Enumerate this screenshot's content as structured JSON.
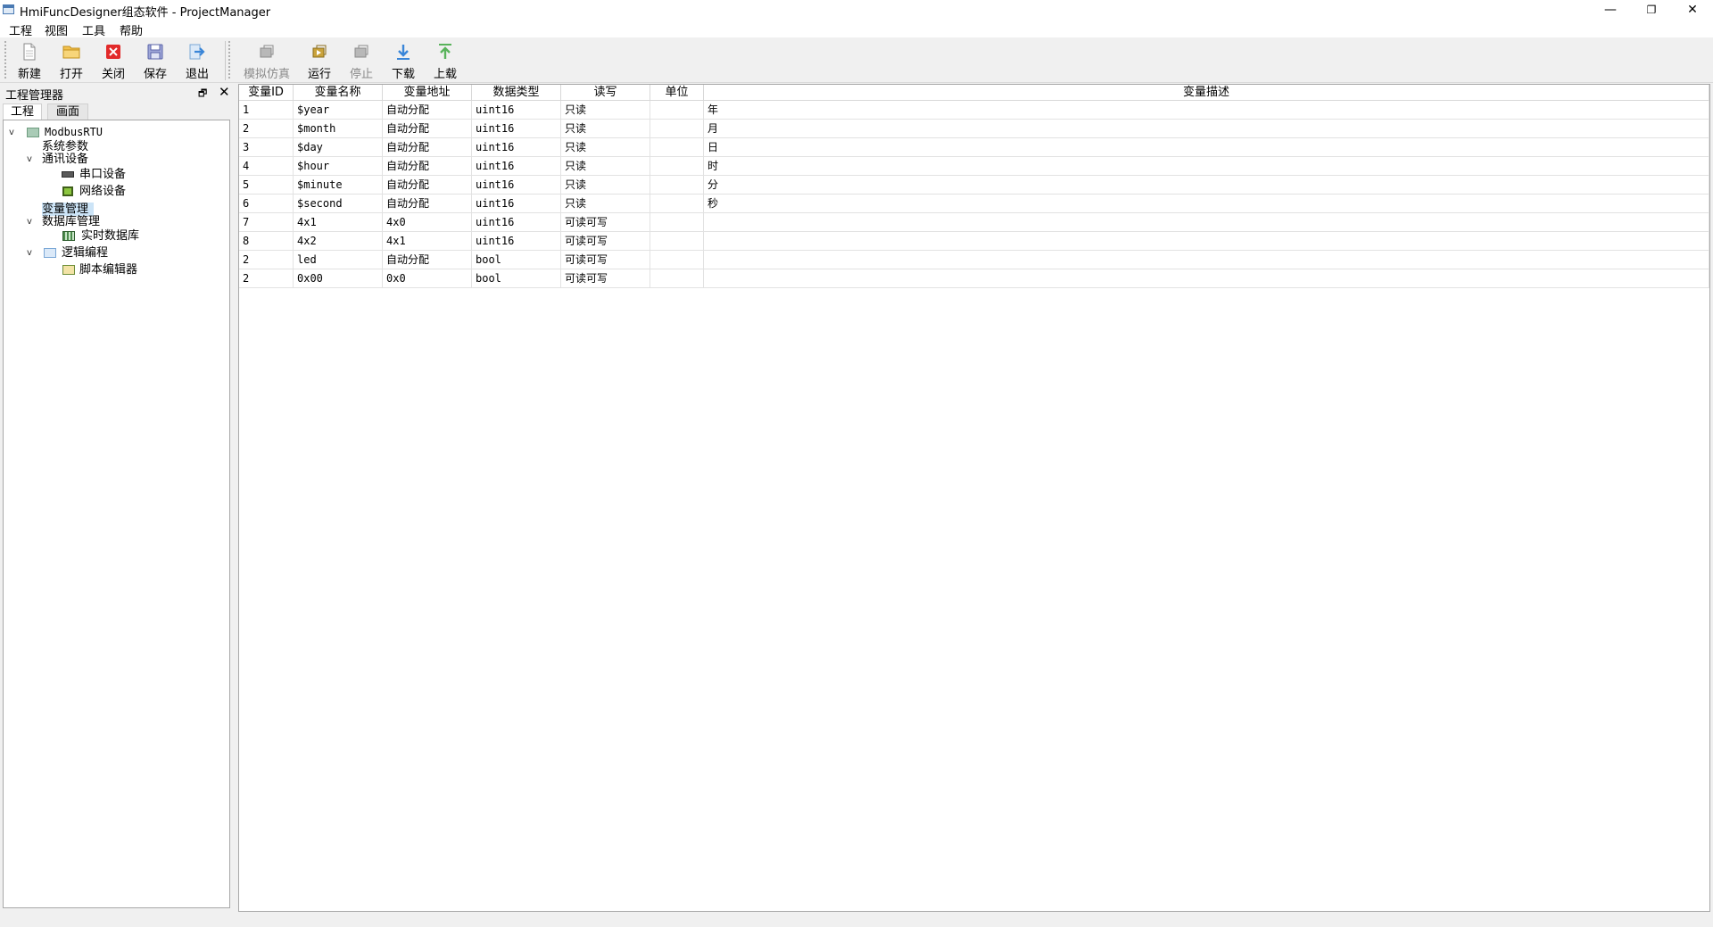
{
  "window": {
    "title": "HmiFuncDesigner组态软件 - ProjectManager",
    "minimize": "—",
    "restore": "❐",
    "close": "✕"
  },
  "menu": [
    "工程",
    "视图",
    "工具",
    "帮助"
  ],
  "toolbar": {
    "file": [
      {
        "label": "新建",
        "icon": "new-file-icon"
      },
      {
        "label": "打开",
        "icon": "open-folder-icon"
      },
      {
        "label": "关闭",
        "icon": "close-red-icon"
      },
      {
        "label": "保存",
        "icon": "save-disk-icon"
      },
      {
        "label": "退出",
        "icon": "exit-arrow-icon"
      }
    ],
    "run": [
      {
        "label": "模拟仿真",
        "icon": "simulate-icon",
        "enabled": false
      },
      {
        "label": "运行",
        "icon": "run-icon",
        "enabled": true
      },
      {
        "label": "停止",
        "icon": "stop-icon",
        "enabled": false
      },
      {
        "label": "下载",
        "icon": "download-arrow-icon",
        "enabled": true
      },
      {
        "label": "上载",
        "icon": "upload-arrow-icon",
        "enabled": true
      }
    ]
  },
  "dock": {
    "title": "工程管理器",
    "float_glyph": "🗗",
    "close_glyph": "✕",
    "tabs": [
      "工程",
      "画面"
    ]
  },
  "tree": {
    "expander_open": "v",
    "nodes": [
      {
        "label": "ModbusRTU",
        "level": 0,
        "expander": true,
        "icon": "project-icon"
      },
      {
        "label": "系统参数",
        "level": 1
      },
      {
        "label": "通讯设备",
        "level": 1,
        "expander": true
      },
      {
        "label": "串口设备",
        "level": 2,
        "icon": "serial-port-icon"
      },
      {
        "label": "网络设备",
        "level": 2,
        "icon": "network-device-icon"
      },
      {
        "label": "变量管理",
        "level": 1,
        "selected": true
      },
      {
        "label": "数据库管理",
        "level": 1,
        "expander": true
      },
      {
        "label": "实时数据库",
        "level": 2,
        "icon": "database-icon"
      },
      {
        "label": "逻辑编程",
        "level": 1,
        "expander": true,
        "icon": "logic-icon"
      },
      {
        "label": "脚本编辑器",
        "level": 2,
        "icon": "script-editor-icon"
      }
    ]
  },
  "table": {
    "columns": [
      "变量ID",
      "变量名称",
      "变量地址",
      "数据类型",
      "读写",
      "单位",
      "变量描述"
    ],
    "rows": [
      [
        "1",
        "$year",
        "自动分配",
        "uint16",
        "只读",
        "",
        "年"
      ],
      [
        "2",
        "$month",
        "自动分配",
        "uint16",
        "只读",
        "",
        "月"
      ],
      [
        "3",
        "$day",
        "自动分配",
        "uint16",
        "只读",
        "",
        "日"
      ],
      [
        "4",
        "$hour",
        "自动分配",
        "uint16",
        "只读",
        "",
        "时"
      ],
      [
        "5",
        "$minute",
        "自动分配",
        "uint16",
        "只读",
        "",
        "分"
      ],
      [
        "6",
        "$second",
        "自动分配",
        "uint16",
        "只读",
        "",
        "秒"
      ],
      [
        "7",
        "4x1",
        "4x0",
        "uint16",
        "可读可写",
        "",
        ""
      ],
      [
        "8",
        "4x2",
        "4x1",
        "uint16",
        "可读可写",
        "",
        ""
      ],
      [
        "2",
        "led",
        "自动分配",
        "bool",
        "可读可写",
        "",
        ""
      ],
      [
        "2",
        "0x00",
        "0x0",
        "bool",
        "可读可写",
        "",
        ""
      ]
    ]
  },
  "colors": {
    "selection": "#cce4f7",
    "close_red": "#e22a2a",
    "folder": "#f2c14e",
    "arrow_blue": "#3a86d8",
    "arrow_green": "#59b35b"
  }
}
